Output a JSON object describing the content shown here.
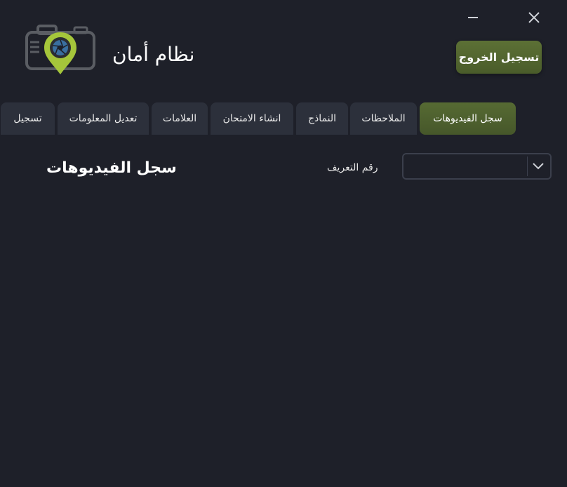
{
  "app": {
    "title": "نظام أمان",
    "logout_label": "تسجيل الخروج",
    "accent_color": "#4f6230",
    "background_color": "#1e2029"
  },
  "window_controls": {
    "minimize_icon": "minimize-icon",
    "close_icon": "close-icon"
  },
  "tabs": [
    {
      "label": "سجل الفيديوهات",
      "active": true
    },
    {
      "label": "الملاحظات",
      "active": false
    },
    {
      "label": "النماذج",
      "active": false
    },
    {
      "label": "انشاء الامتحان",
      "active": false
    },
    {
      "label": "العلامات",
      "active": false
    },
    {
      "label": "تعديل المعلومات",
      "active": false
    },
    {
      "label": "تسجيل",
      "active": false
    }
  ],
  "main": {
    "section_title": "سجل الفيديوهات",
    "id_label": "رقم التعريف",
    "id_value": ""
  }
}
